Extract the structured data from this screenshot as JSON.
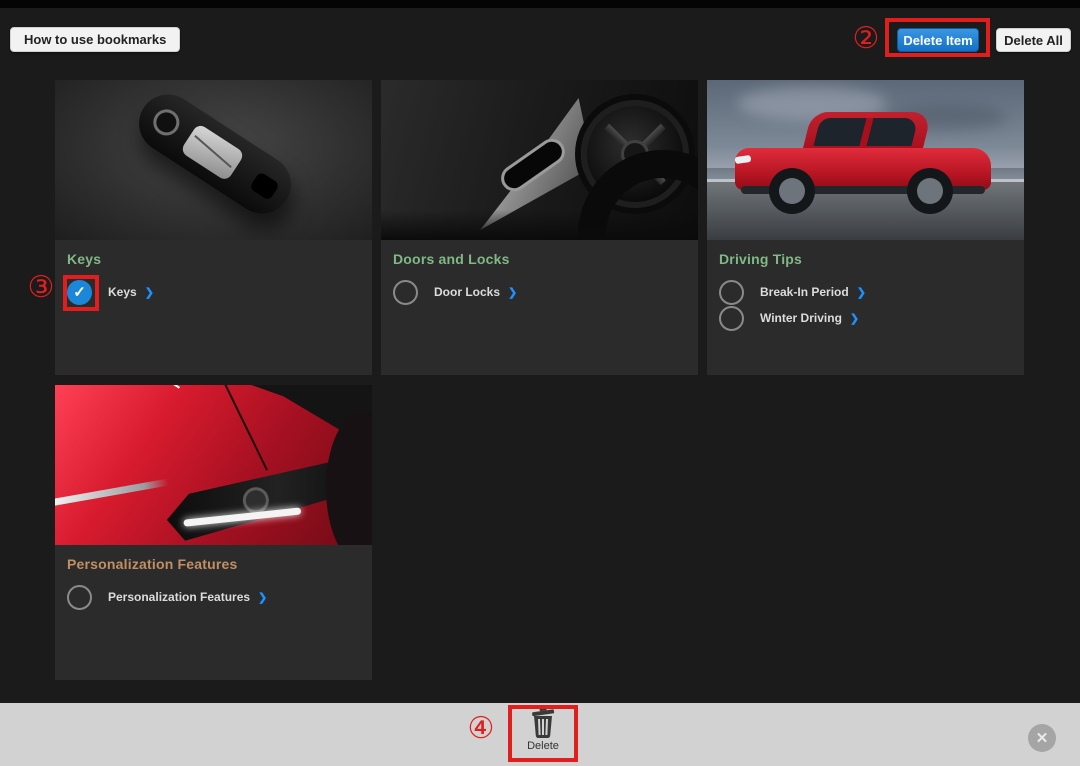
{
  "header": {
    "help_button": "How to use bookmarks",
    "delete_item_button": "Delete Item",
    "delete_all_button": "Delete All"
  },
  "cards": [
    {
      "title": "Keys",
      "items": [
        {
          "label": "Keys",
          "checked": true
        }
      ]
    },
    {
      "title": "Doors and Locks",
      "items": [
        {
          "label": "Door Locks",
          "checked": false
        }
      ]
    },
    {
      "title": "Driving Tips",
      "items": [
        {
          "label": "Break-In Period",
          "checked": false
        },
        {
          "label": "Winter Driving",
          "checked": false
        }
      ]
    },
    {
      "title": "Personalization Features",
      "items": [
        {
          "label": "Personalization Features",
          "checked": false
        }
      ]
    }
  ],
  "footer": {
    "delete_label": "Delete"
  },
  "annotations": {
    "step2": "②",
    "step3": "③",
    "step4": "④"
  },
  "icons": {
    "chevron": "❯",
    "check": "✓",
    "close": "✕"
  },
  "colors": {
    "accent_blue": "#1d80d8",
    "checkbox_blue": "#1b87d9",
    "link_chevron": "#1e90ff",
    "title_green": "#80b985",
    "title_tan": "#c28e62",
    "annotation_red": "#e01e1e",
    "bottom_bar_gray": "#d2d2d2",
    "background": "#1b1b1b",
    "card_background": "#2b2b2b"
  }
}
